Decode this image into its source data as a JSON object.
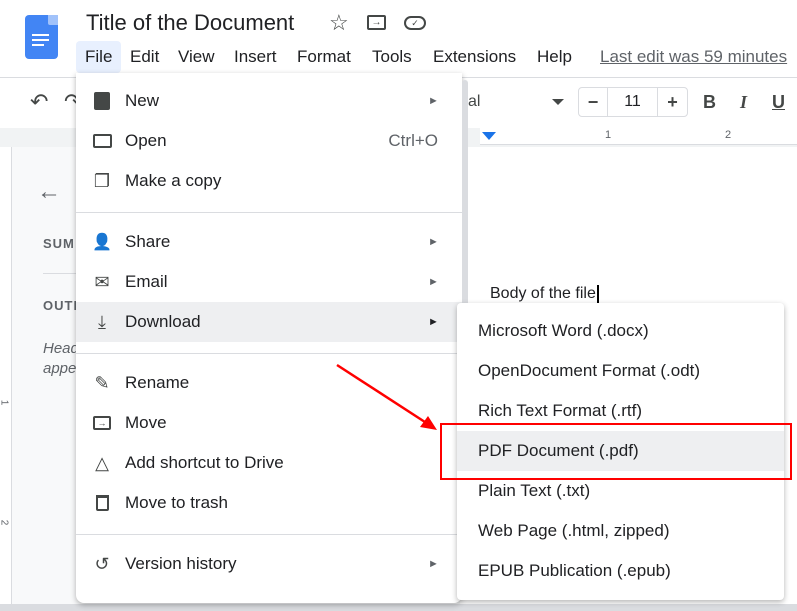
{
  "header": {
    "title": "Title of the Document",
    "star_icon": "star-icon",
    "move_icon": "folder-move-icon",
    "cloud_icon": "cloud-saved-icon",
    "last_edit": "Last edit was 59 minutes"
  },
  "menubar": [
    "File",
    "Edit",
    "View",
    "Insert",
    "Format",
    "Tools",
    "Extensions",
    "Help"
  ],
  "toolbar": {
    "font_partial": "al",
    "font_size": "11",
    "minus": "−",
    "plus": "+",
    "bold": "B",
    "italic": "I",
    "underline": "U"
  },
  "ruler": {
    "marks": [
      "1",
      "2"
    ]
  },
  "left_ruler": {
    "marks": [
      "1",
      "2"
    ]
  },
  "outline_panel": {
    "summary": "SUM",
    "outline": "OUTL",
    "hint_line1": "Head",
    "hint_line2": "appe"
  },
  "document": {
    "body": "Body of the file"
  },
  "file_menu": {
    "items": [
      {
        "label": "New",
        "icon": "document-icon",
        "submenu": true
      },
      {
        "label": "Open",
        "icon": "folder-icon",
        "shortcut": "Ctrl+O"
      },
      {
        "label": "Make a copy",
        "icon": "copy-icon"
      },
      {
        "label": "Share",
        "icon": "person-add-icon",
        "submenu": true
      },
      {
        "label": "Email",
        "icon": "mail-icon",
        "submenu": true
      },
      {
        "label": "Download",
        "icon": "download-icon",
        "submenu": true,
        "highlighted": true
      },
      {
        "label": "Rename",
        "icon": "pencil-icon"
      },
      {
        "label": "Move",
        "icon": "folder-move-icon"
      },
      {
        "label": "Add shortcut to Drive",
        "icon": "drive-shortcut-icon"
      },
      {
        "label": "Move to trash",
        "icon": "trash-icon"
      },
      {
        "label": "Version history",
        "icon": "history-icon",
        "submenu": true
      }
    ]
  },
  "download_submenu": {
    "items": [
      "Microsoft Word (.docx)",
      "OpenDocument Format (.odt)",
      "Rich Text Format (.rtf)",
      "PDF Document (.pdf)",
      "Plain Text (.txt)",
      "Web Page (.html, zipped)",
      "EPUB Publication (.epub)"
    ],
    "highlighted": "PDF Document (.pdf)"
  },
  "annotation": {
    "color": "#ff0000"
  }
}
